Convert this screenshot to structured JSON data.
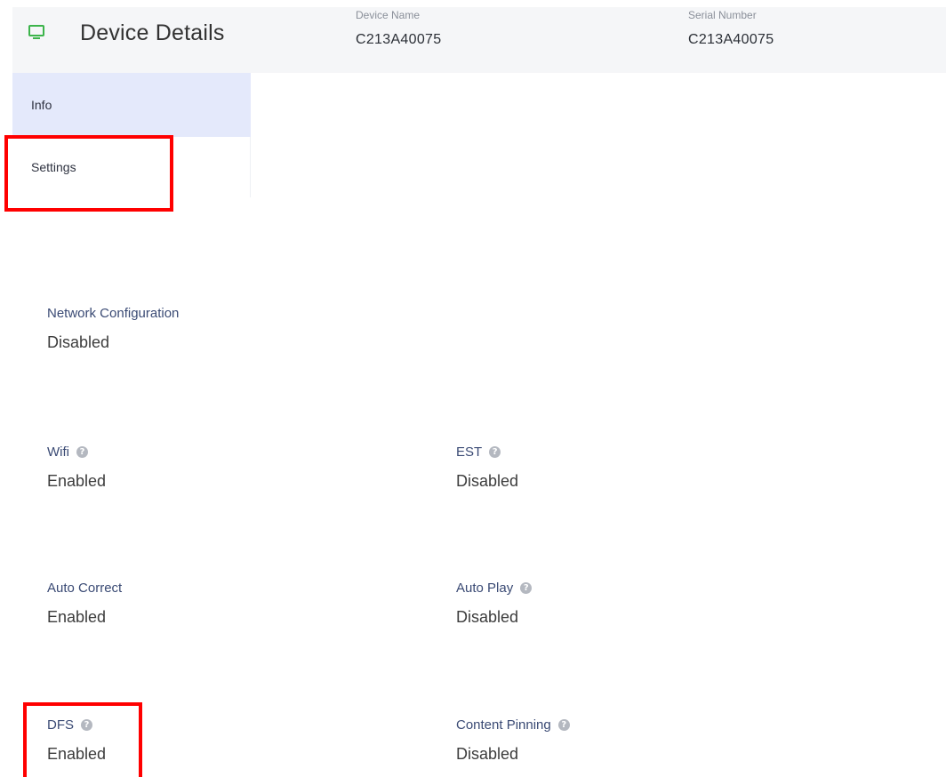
{
  "header": {
    "title": "Device Details",
    "icon": "monitor-icon",
    "icon_color": "#3cb44b",
    "device_name": {
      "label": "Device Name",
      "value": "C213A40075"
    },
    "serial_number": {
      "label": "Serial Number",
      "value": "C213A40075"
    }
  },
  "tabs": [
    {
      "label": "Info",
      "active": true
    },
    {
      "label": "Settings",
      "active": false
    }
  ],
  "settings": {
    "network_configuration": {
      "label": "Network Configuration",
      "value": "Disabled",
      "help": false
    },
    "wifi": {
      "label": "Wifi",
      "value": "Enabled",
      "help": true
    },
    "est": {
      "label": "EST",
      "value": "Disabled",
      "help": true
    },
    "auto_correct": {
      "label": "Auto Correct",
      "value": "Enabled",
      "help": false
    },
    "auto_play": {
      "label": "Auto Play",
      "value": "Disabled",
      "help": true
    },
    "dfs": {
      "label": "DFS",
      "value": "Enabled",
      "help": true
    },
    "content_pinning": {
      "label": "Content Pinning",
      "value": "Disabled",
      "help": true
    }
  },
  "help_icon_glyph": "?",
  "colors": {
    "accent_tab_bg": "#e4e9fb",
    "label_color": "#3a4a74",
    "annotation_red": "#ff0000"
  }
}
